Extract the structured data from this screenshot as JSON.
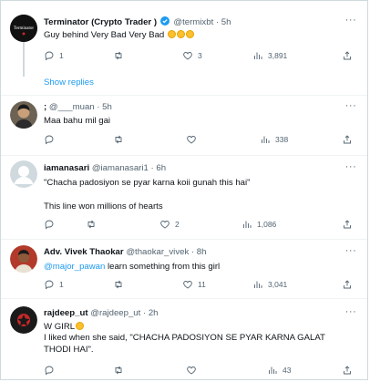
{
  "tweets": [
    {
      "name": "Terminator (Crypto Trader )",
      "handle": "@termixbt",
      "time": "5h",
      "text": "Guy behind Very Bad Very Bad",
      "replies": "1",
      "retweets": "",
      "likes": "3",
      "views": "3,891",
      "show_replies": "Show replies",
      "avatar_text": "Terminator"
    },
    {
      "name": ";",
      "handle": "@___muan",
      "time": "5h",
      "text": "Maa bahu mil gai",
      "replies": "",
      "retweets": "",
      "likes": "",
      "views": "338"
    },
    {
      "name": "iamanasari",
      "handle": "@iamanasari1",
      "time": "6h",
      "text_line1": "\"Chacha padosiyon se pyar karna koii gunah this hai\"",
      "text_line2": "This line won millions of hearts",
      "replies": "",
      "retweets": "",
      "likes": "2",
      "views": "1,086"
    },
    {
      "name": "Adv. Vivek Thaokar",
      "handle": "@thaokar_vivek",
      "time": "8h",
      "mention": "@major_pawan",
      "text": " learn something from this girl",
      "replies": "1",
      "retweets": "",
      "likes": "11",
      "views": "3,041"
    },
    {
      "name": "rajdeep_ut",
      "handle": "@rajdeep_ut",
      "time": "2h",
      "text_line1": "W GIRL",
      "text_line2": "I liked when she said, \"CHACHA PADOSIYON SE PYAR KARNA GALAT THODI HAI\".",
      "replies": "",
      "retweets": "",
      "likes": "",
      "views": "43"
    }
  ],
  "common": {
    "dot": "·",
    "more": "···"
  },
  "colors": {
    "accent": "#1d9bf0",
    "muted": "#536471",
    "verified": "#1d9bf0"
  }
}
